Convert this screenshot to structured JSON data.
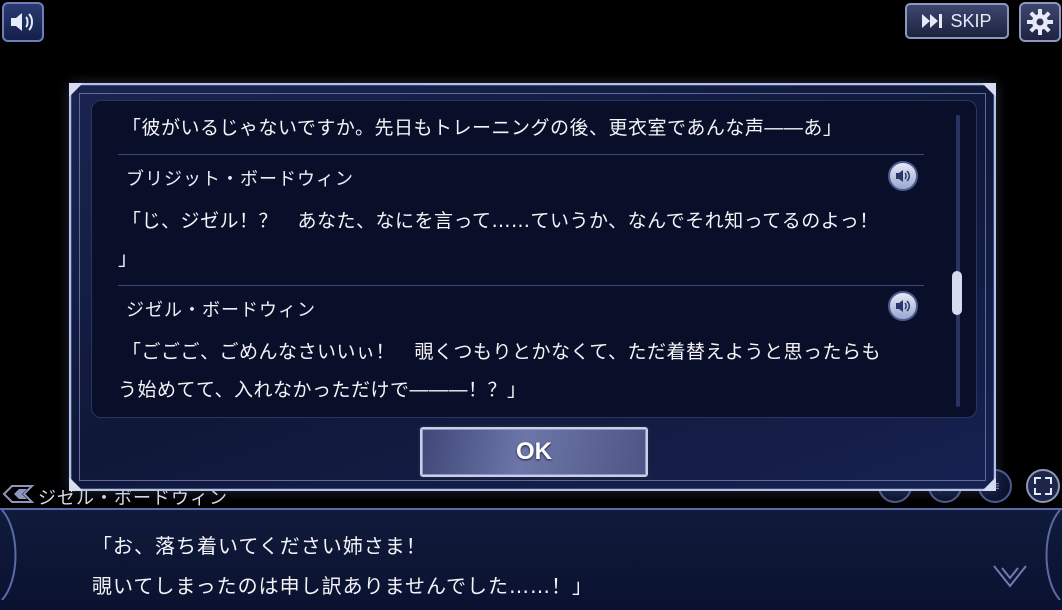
{
  "top_bar": {
    "skip_label": "SKIP"
  },
  "dialogue": {
    "speaker": "ジゼル・ボードウィン",
    "line1": "「お、落ち着いてください姉さま！",
    "line2": "覗いてしまったのは申し訳ありませんでした……！」"
  },
  "log": {
    "entries": [
      {
        "lines": [
          "「彼がいるじゃないですか。先日もトレーニングの後、更衣室であんな声――あ」"
        ]
      },
      {
        "speaker": "ブリジット・ボードウィン",
        "lines": [
          "「じ、ジゼル！？　あなた、なにを言って……ていうか、なんでそれ知ってるのよっ！",
          "」"
        ]
      },
      {
        "speaker": "ジゼル・ボードウィン",
        "lines": [
          "「ごごご、ごめんなさいいぃ！　覗くつもりとかなくて、ただ着替えようと思ったらも",
          "う始めてて、入れなかっただけで―――！？」"
        ]
      }
    ]
  },
  "modal": {
    "ok_label": "OK"
  },
  "colors": {
    "modal_border": "#b7c0de",
    "panel_bg": "#090f28",
    "accent": "#6c7fb8"
  }
}
